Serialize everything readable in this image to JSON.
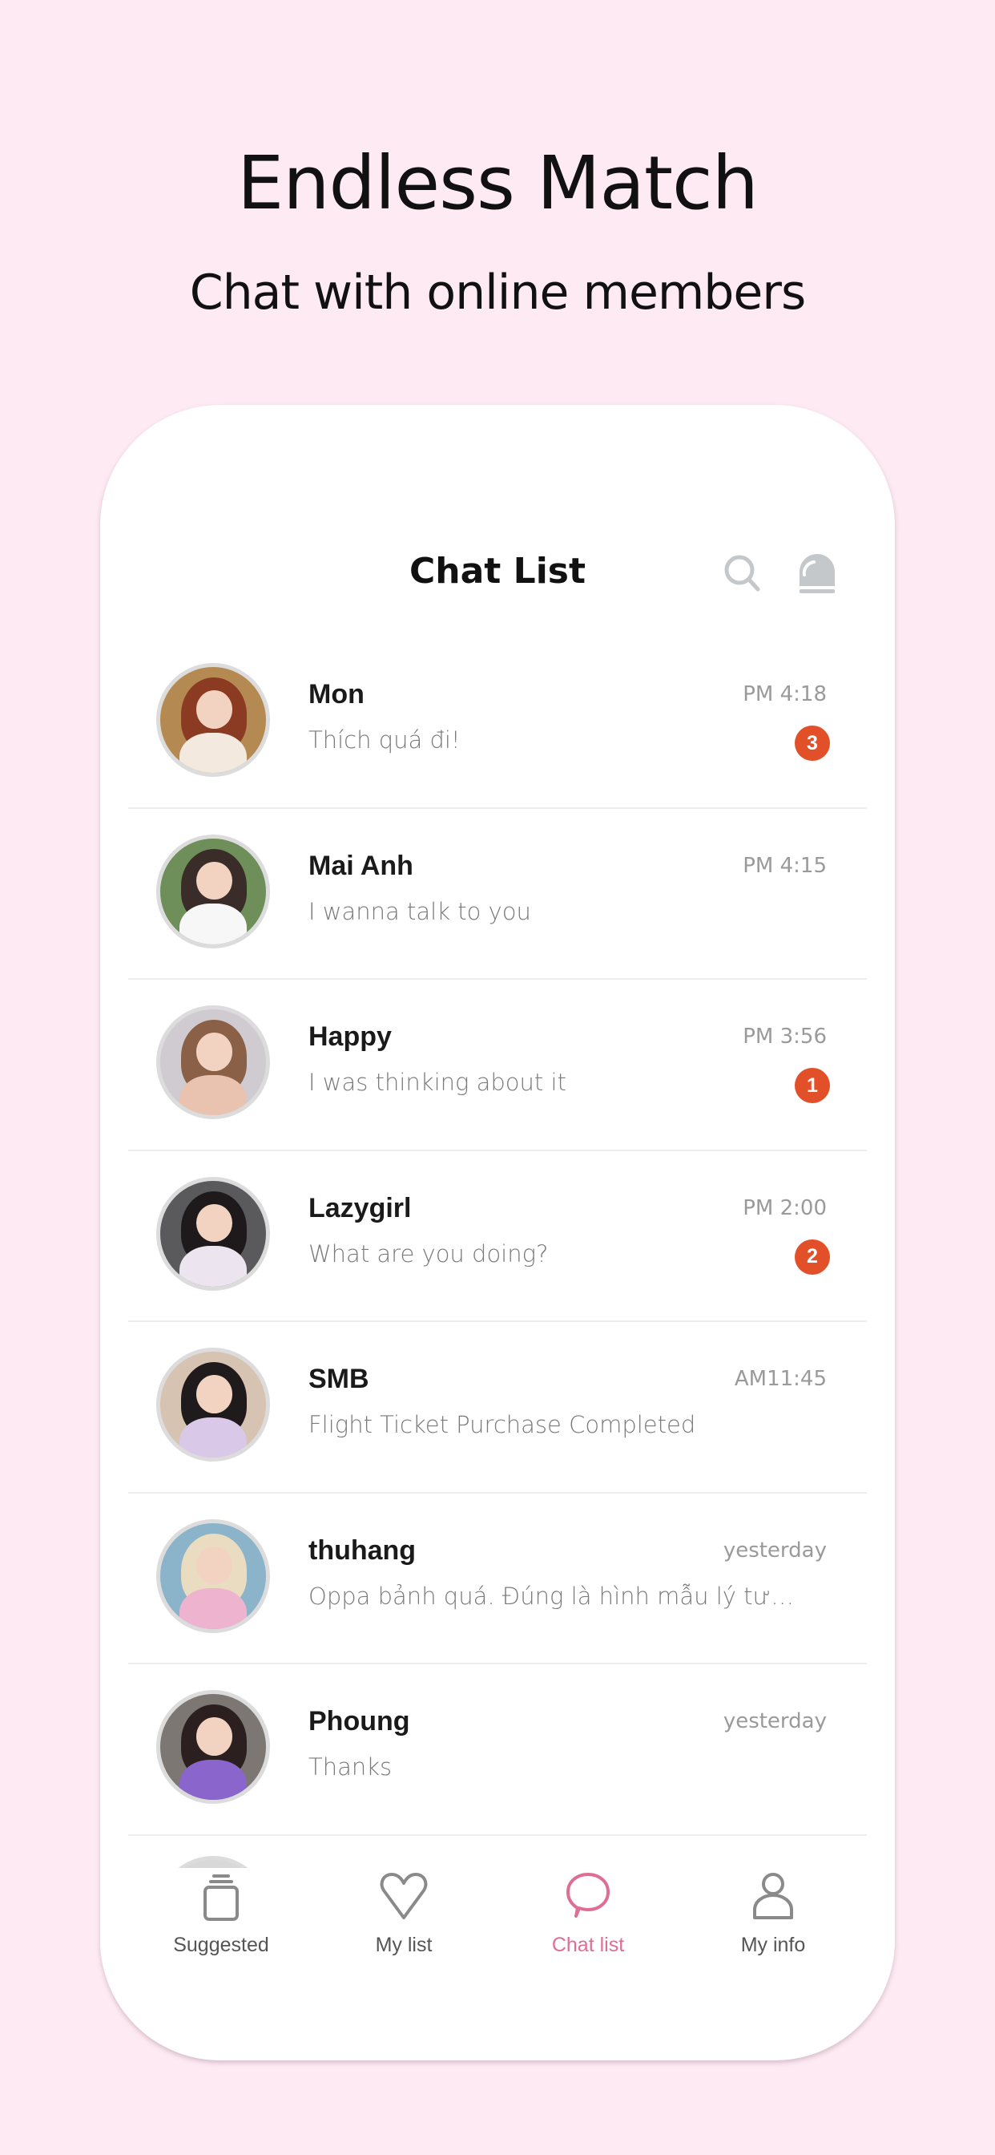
{
  "hero": {
    "title": "Endless Match",
    "subtitle": "Chat with online members"
  },
  "colors": {
    "background": "#fdeaf2",
    "badge": "#e2502a",
    "active_tab": "#de6e94",
    "icon_gray": "#c5c8cb",
    "tab_gray": "#8a8a8a"
  },
  "appbar": {
    "title": "Chat List",
    "icons": [
      "search-icon",
      "siren-icon"
    ]
  },
  "chats": [
    {
      "name": "Mon",
      "message": "Thích quá đi!",
      "time": "PM 4:18",
      "unread": "3",
      "avatar": {
        "hair": "#8a3b22",
        "body": "#f3e9de",
        "bg": "#b58a52"
      }
    },
    {
      "name": "Mai Anh",
      "message": "I wanna talk to you",
      "time": "PM 4:15",
      "unread": "",
      "avatar": {
        "hair": "#3a2c28",
        "body": "#f7f7f7",
        "bg": "#6f8f5a"
      }
    },
    {
      "name": "Happy",
      "message": "I was thinking about it",
      "time": "PM 3:56",
      "unread": "1",
      "avatar": {
        "hair": "#8a6046",
        "body": "#e9c3b0",
        "bg": "#cfcbd0"
      }
    },
    {
      "name": "Lazygirl",
      "message": "What are you doing?",
      "time": "PM 2:00",
      "unread": "2",
      "avatar": {
        "hair": "#1e1a1c",
        "body": "#ece4ee",
        "bg": "#5a5a5c"
      }
    },
    {
      "name": "SMB",
      "message": "Flight Ticket Purchase Completed",
      "time": "AM11:45",
      "unread": "",
      "avatar": {
        "hair": "#1f1a1b",
        "body": "#d9c8e8",
        "bg": "#d7c3b2"
      }
    },
    {
      "name": "thuhang",
      "message": "Oppa bảnh quá. Đúng là hình mẫu lý tưởng...",
      "time": "yesterday",
      "unread": "",
      "avatar": {
        "hair": "#e9dcc0",
        "body": "#eeb3cf",
        "bg": "#8bb3c9"
      }
    },
    {
      "name": "Phoung",
      "message": "Thanks",
      "time": "yesterday",
      "unread": "",
      "avatar": {
        "hair": "#2c1f20",
        "body": "#8a66cc",
        "bg": "#7c7772"
      }
    }
  ],
  "tabs": [
    {
      "label": "Suggested",
      "icon": "cards-stack-icon",
      "active": false
    },
    {
      "label": "My list",
      "icon": "heart-icon",
      "active": false
    },
    {
      "label": "Chat list",
      "icon": "chat-bubble-icon",
      "active": true
    },
    {
      "label": "My info",
      "icon": "person-icon",
      "active": false
    }
  ]
}
